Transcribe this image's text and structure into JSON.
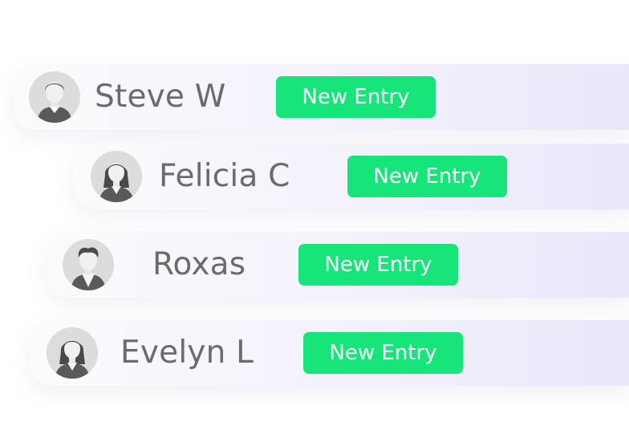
{
  "entries": [
    {
      "name": "Steve W",
      "button_label": "New Entry",
      "avatar_icon": "male-avatar-icon"
    },
    {
      "name": "Felicia C",
      "button_label": "New Entry",
      "avatar_icon": "female-avatar-icon"
    },
    {
      "name": "Roxas",
      "button_label": "New Entry",
      "avatar_icon": "male-avatar-icon"
    },
    {
      "name": "Evelyn L",
      "button_label": "New Entry",
      "avatar_icon": "female-avatar-icon"
    }
  ],
  "colors": {
    "button": "#16e579",
    "name_text": "#6b6b6e",
    "row_gradient_end": "#ebe7fb"
  }
}
